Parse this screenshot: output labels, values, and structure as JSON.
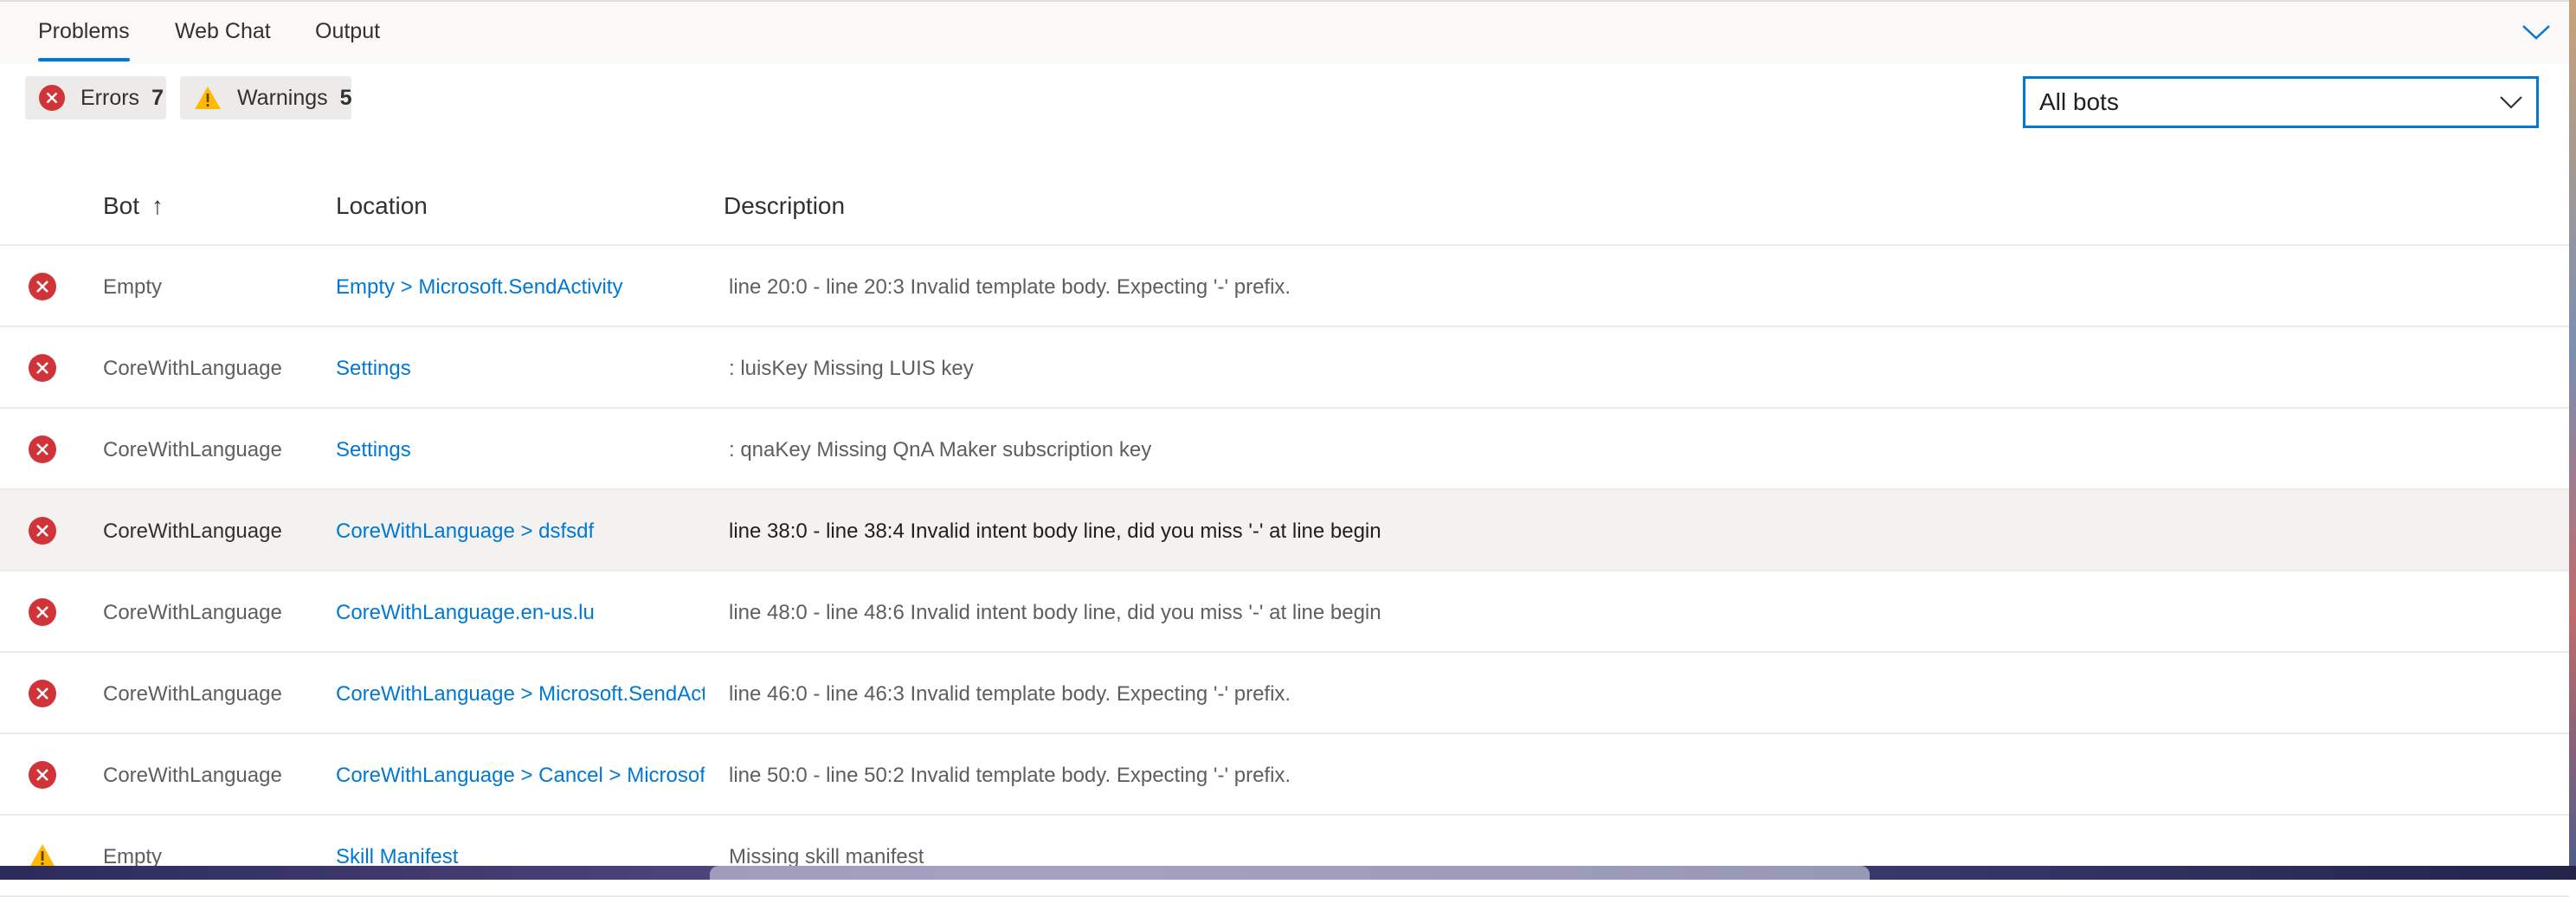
{
  "tabs": [
    {
      "label": "Problems",
      "active": true
    },
    {
      "label": "Web Chat",
      "active": false
    },
    {
      "label": "Output",
      "active": false
    }
  ],
  "filters": {
    "errors": {
      "label": "Errors",
      "count": "7"
    },
    "warnings": {
      "label": "Warnings",
      "count": "5"
    }
  },
  "bot_select": {
    "selected": "All bots"
  },
  "table": {
    "headers": {
      "bot": "Bot",
      "sort_arrow": "↑",
      "location": "Location",
      "description": "Description"
    },
    "rows": [
      {
        "severity": "error",
        "bot": "Empty",
        "location": "Empty > Microsoft.SendActivity",
        "description": "line 20:0 - line 20:3 Invalid template body. Expecting '-' prefix."
      },
      {
        "severity": "error",
        "bot": "CoreWithLanguage",
        "location": "Settings",
        "description": ": luisKey Missing LUIS key"
      },
      {
        "severity": "error",
        "bot": "CoreWithLanguage",
        "location": "Settings",
        "description": ": qnaKey Missing QnA Maker subscription key"
      },
      {
        "severity": "error",
        "bot": "CoreWithLanguage",
        "location": "CoreWithLanguage > dsfsdf",
        "description": "line 38:0 - line 38:4 Invalid intent body line, did you miss '-' at line begin"
      },
      {
        "severity": "error",
        "bot": "CoreWithLanguage",
        "location": "CoreWithLanguage.en-us.lu",
        "description": "line 48:0 - line 48:6 Invalid intent body line, did you miss '-' at line begin"
      },
      {
        "severity": "error",
        "bot": "CoreWithLanguage",
        "location": "CoreWithLanguage > Microsoft.SendAct",
        "description": "line 46:0 - line 46:3 Invalid template body. Expecting '-' prefix."
      },
      {
        "severity": "error",
        "bot": "CoreWithLanguage",
        "location": "CoreWithLanguage > Cancel > Microsof",
        "description": "line 50:0 - line 50:2 Invalid template body. Expecting '-' prefix."
      },
      {
        "severity": "warning",
        "bot": "Empty",
        "location": "Skill Manifest",
        "description": "Missing skill manifest"
      }
    ]
  },
  "colors": {
    "accent": "#0078d4",
    "error": "#d13438",
    "warning": "#ffb900"
  }
}
